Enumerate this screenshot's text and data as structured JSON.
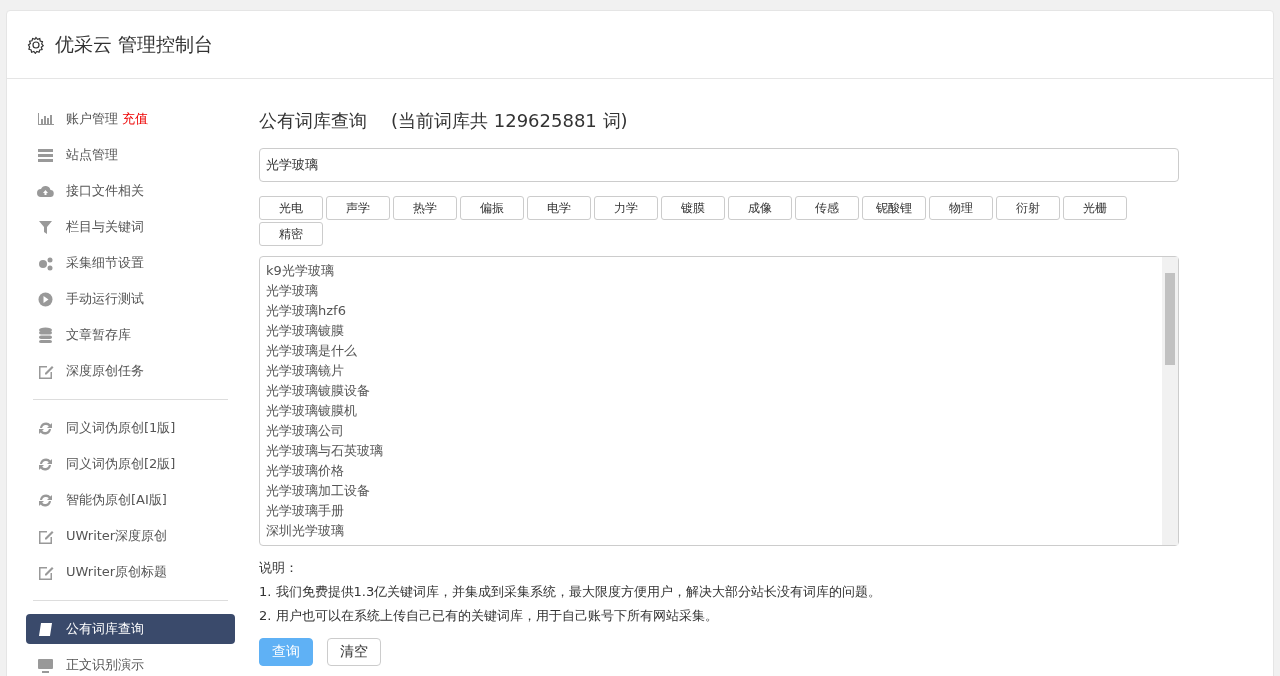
{
  "header": {
    "title": "优采云 管理控制台"
  },
  "sidebar": {
    "groups": [
      {
        "items": [
          {
            "label": "账户管理",
            "badge": "充值",
            "selected": false
          },
          {
            "label": "站点管理",
            "selected": false
          },
          {
            "label": "接口文件相关",
            "selected": false
          },
          {
            "label": "栏目与关键词",
            "selected": false
          },
          {
            "label": "采集细节设置",
            "selected": false
          },
          {
            "label": "手动运行测试",
            "selected": false
          },
          {
            "label": "文章暂存库",
            "selected": false
          },
          {
            "label": "深度原创任务",
            "selected": false
          }
        ]
      },
      {
        "items": [
          {
            "label": "同义词伪原创[1版]",
            "selected": false
          },
          {
            "label": "同义词伪原创[2版]",
            "selected": false
          },
          {
            "label": "智能伪原创[AI版]",
            "selected": false
          },
          {
            "label": "UWriter深度原创",
            "selected": false
          },
          {
            "label": "UWriter原创标题",
            "selected": false
          }
        ]
      },
      {
        "items": [
          {
            "label": "公有词库查询",
            "selected": true
          },
          {
            "label": "正文识别演示",
            "selected": false
          }
        ]
      }
    ]
  },
  "main": {
    "title": "公有词库查询",
    "count_note": "(当前词库共 129625881 词)",
    "search": {
      "value": "光学玻璃"
    },
    "tags": [
      "光电",
      "声学",
      "热学",
      "偏振",
      "电学",
      "力学",
      "镀膜",
      "成像",
      "传感",
      "铌酸锂",
      "物理",
      "衍射",
      "光栅",
      "精密"
    ],
    "results": [
      "k9光学玻璃",
      "光学玻璃",
      "光学玻璃hzf6",
      "光学玻璃镀膜",
      "光学玻璃是什么",
      "光学玻璃镜片",
      "光学玻璃镀膜设备",
      "光学玻璃镀膜机",
      "光学玻璃公司",
      "光学玻璃与石英玻璃",
      "光学玻璃价格",
      "光学玻璃加工设备",
      "光学玻璃手册",
      "深圳光学玻璃"
    ],
    "notes_title": "说明：",
    "notes": [
      "1. 我们免费提供1.3亿关键词库，并集成到采集系统，最大限度方便用户，解决大部分站长没有词库的问题。",
      "2. 用户也可以在系统上传自己已有的关键词库，用于自己账号下所有网站采集。"
    ],
    "buttons": [
      {
        "label": "查询",
        "kind": "primary"
      },
      {
        "label": "清空",
        "kind": "default"
      }
    ]
  }
}
